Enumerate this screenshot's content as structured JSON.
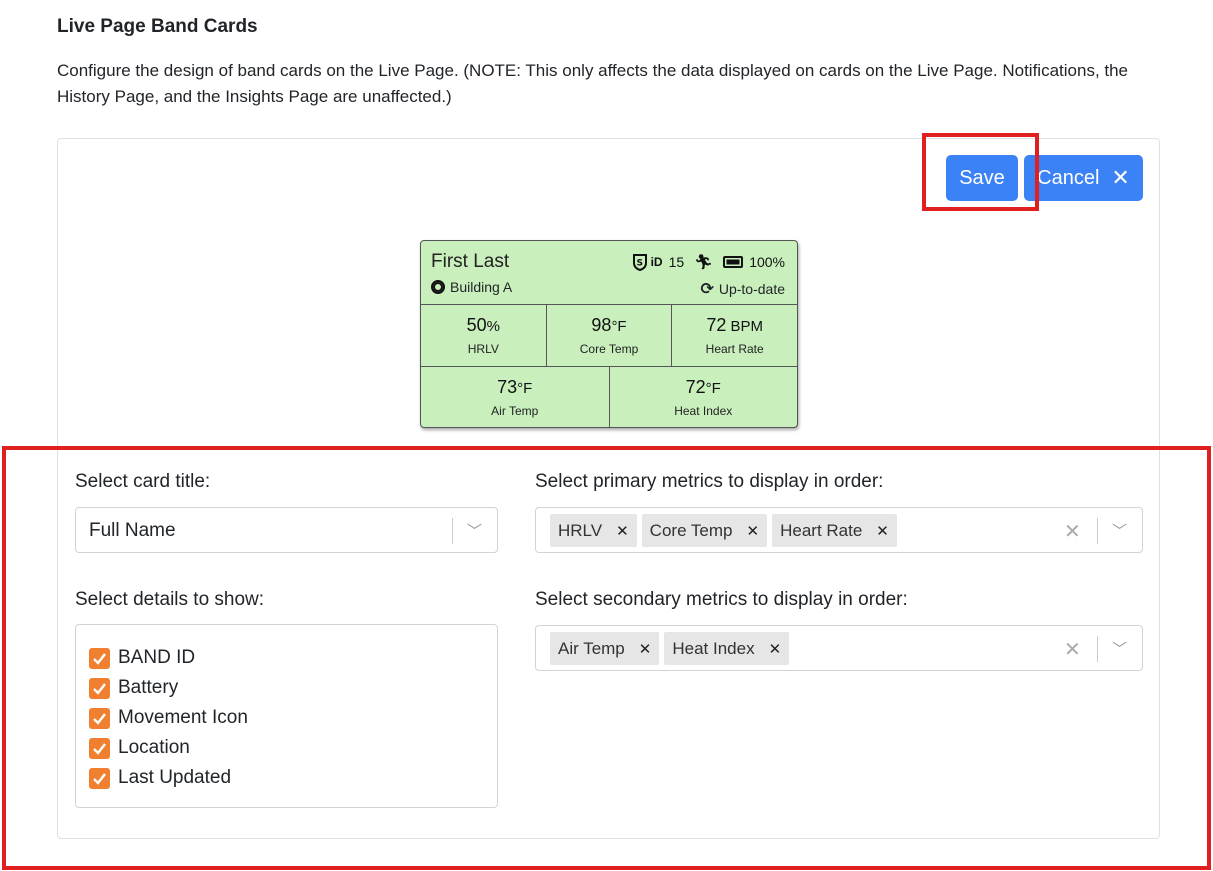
{
  "page": {
    "heading": "Live Page Band Cards",
    "description": "Configure the design of band cards on the Live Page. (NOTE: This only affects the data displayed on cards on the Live Page. Notifications, the History Page, and the Insights Page are unaffected.)"
  },
  "actions": {
    "save_label": "Save",
    "cancel_label": "Cancel"
  },
  "preview_card": {
    "title": "First Last",
    "band_id": "15",
    "battery": "100%",
    "location": "Building A",
    "last_updated": "Up-to-date",
    "primary_metrics": [
      {
        "value": "50",
        "unit": "%",
        "label": "HRLV"
      },
      {
        "value": "98",
        "unit": "°F",
        "label": "Core Temp"
      },
      {
        "value": "72",
        "unit": " BPM",
        "label": "Heart Rate"
      }
    ],
    "secondary_metrics": [
      {
        "value": "73",
        "unit": "°F",
        "label": "Air Temp"
      },
      {
        "value": "72",
        "unit": "°F",
        "label": "Heat Index"
      }
    ]
  },
  "form": {
    "card_title_label": "Select card title:",
    "card_title_value": "Full Name",
    "details_label": "Select details to show:",
    "details": [
      "BAND ID",
      "Battery",
      "Movement Icon",
      "Location",
      "Last Updated"
    ],
    "primary_label": "Select primary metrics to display in order:",
    "primary_selected": [
      "HRLV",
      "Core Temp",
      "Heart Rate"
    ],
    "secondary_label": "Select secondary metrics to display in order:",
    "secondary_selected": [
      "Air Temp",
      "Heat Index"
    ]
  },
  "colors": {
    "accent": "#3b82f6",
    "card_bg": "#c9efbd",
    "checkbox": "#f08030",
    "highlight": "#e0201e"
  }
}
